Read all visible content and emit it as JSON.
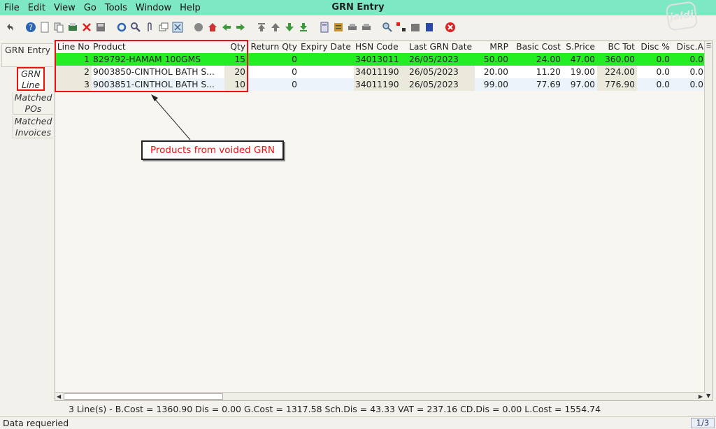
{
  "menu": {
    "items": [
      "File",
      "Edit",
      "View",
      "Go",
      "Tools",
      "Window",
      "Help"
    ]
  },
  "window_title": "GRN Entry",
  "logo_text": "jaldi",
  "toolbar": {
    "icons": [
      "undo-icon",
      "help-icon",
      "new-icon",
      "copy-icon",
      "print-icon",
      "delete-icon",
      "save-icon",
      "refresh-icon",
      "find-icon",
      "attach-icon",
      "multi-window-icon",
      "zoom-icon",
      "history-icon",
      "home-icon",
      "prev-icon",
      "next-icon",
      "first-icon",
      "up-icon",
      "down-icon",
      "last-icon",
      "report-icon",
      "archive-icon",
      "print-preview-icon",
      "print2-icon",
      "zoom-across-icon",
      "workflow-icon",
      "product-icon",
      "export-icon",
      "close-icon"
    ]
  },
  "side_tabs": {
    "grn_entry": "GRN Entry",
    "grn_line": "GRN Line",
    "matched_pos": "Matched POs",
    "matched_invoices": "Matched Invoices"
  },
  "grid": {
    "headers": {
      "line_no": "Line No",
      "product": "Product",
      "qty": "Qty",
      "return_qty": "Return Qty",
      "expiry_date": "Expiry Date",
      "hsn_code": "HSN Code",
      "last_grn_date": "Last GRN Date",
      "mrp": "MRP",
      "basic_cost": "Basic Cost",
      "s_price": "S.Price",
      "bc_tot": "BC Tot",
      "disc_pct": "Disc %",
      "disc_a": "Disc.A"
    },
    "rows": [
      {
        "line_no": "1",
        "product": "829792-HAMAM 100GMS",
        "qty": "15",
        "return_qty": "0",
        "expiry_date": "",
        "hsn_code": "34013011",
        "last_grn_date": "26/05/2023",
        "mrp": "50.00",
        "basic_cost": "24.00",
        "s_price": "47.00",
        "bc_tot": "360.00",
        "disc_pct": "0.0",
        "disc_a": "0.0"
      },
      {
        "line_no": "2",
        "product": "9003850-CINTHOL BATH S...",
        "qty": "20",
        "return_qty": "0",
        "expiry_date": "",
        "hsn_code": "34011190",
        "last_grn_date": "26/05/2023",
        "mrp": "20.00",
        "basic_cost": "11.20",
        "s_price": "19.00",
        "bc_tot": "224.00",
        "disc_pct": "0.0",
        "disc_a": "0.0"
      },
      {
        "line_no": "3",
        "product": "9003851-CINTHOL BATH S...",
        "qty": "10",
        "return_qty": "0",
        "expiry_date": "",
        "hsn_code": "34011190",
        "last_grn_date": "26/05/2023",
        "mrp": "99.00",
        "basic_cost": "77.69",
        "s_price": "97.00",
        "bc_tot": "776.90",
        "disc_pct": "0.0",
        "disc_a": "0.0"
      }
    ]
  },
  "annotation": {
    "callout": "Products from voided GRN",
    "color": "#ee1111"
  },
  "summary": "3 Line(s) -   B.Cost = 1360.90   Dis = 0.00   G.Cost = 1317.58   Sch.Dis = 43.33   VAT = 237.16   CD.Dis = 0.00   L.Cost = 1554.74",
  "status": {
    "message": "Data requeried",
    "pager": "1/3"
  },
  "colors": {
    "menubar": "#7ee8c4",
    "selected_row": "#22ee22",
    "annotation": "#ee1111"
  }
}
